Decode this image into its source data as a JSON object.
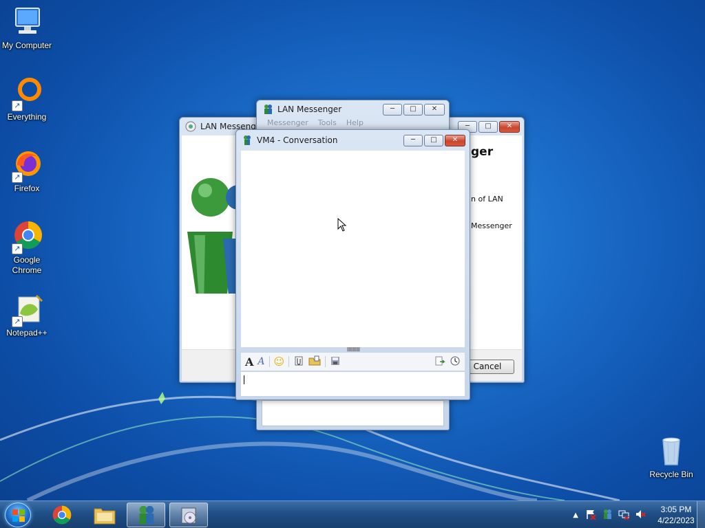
{
  "desktop": {
    "icons": [
      {
        "label": "My Computer"
      },
      {
        "label": "Everything"
      },
      {
        "label": "Firefox"
      },
      {
        "label": "Google Chrome"
      },
      {
        "label": "Notepad++"
      },
      {
        "label": "Recycle Bin"
      }
    ]
  },
  "windows": {
    "about": {
      "title": "LAN Messenger",
      "heading_fragment": "ger",
      "text_line1": "n of LAN",
      "text_line2": "Messenger",
      "cancel_label": "Cancel"
    },
    "main": {
      "title": "LAN Messenger",
      "menu": [
        "Messenger",
        "Tools",
        "Help"
      ]
    },
    "chat": {
      "title": "VM4 - Conversation",
      "splitter_glyph": "||||||||||||||||||",
      "input_value": ""
    }
  },
  "taskbar": {
    "time": "3:05 PM",
    "date": "4/22/2023"
  },
  "colors": {
    "accent": "#1a6cc8",
    "close": "#c9452e"
  }
}
